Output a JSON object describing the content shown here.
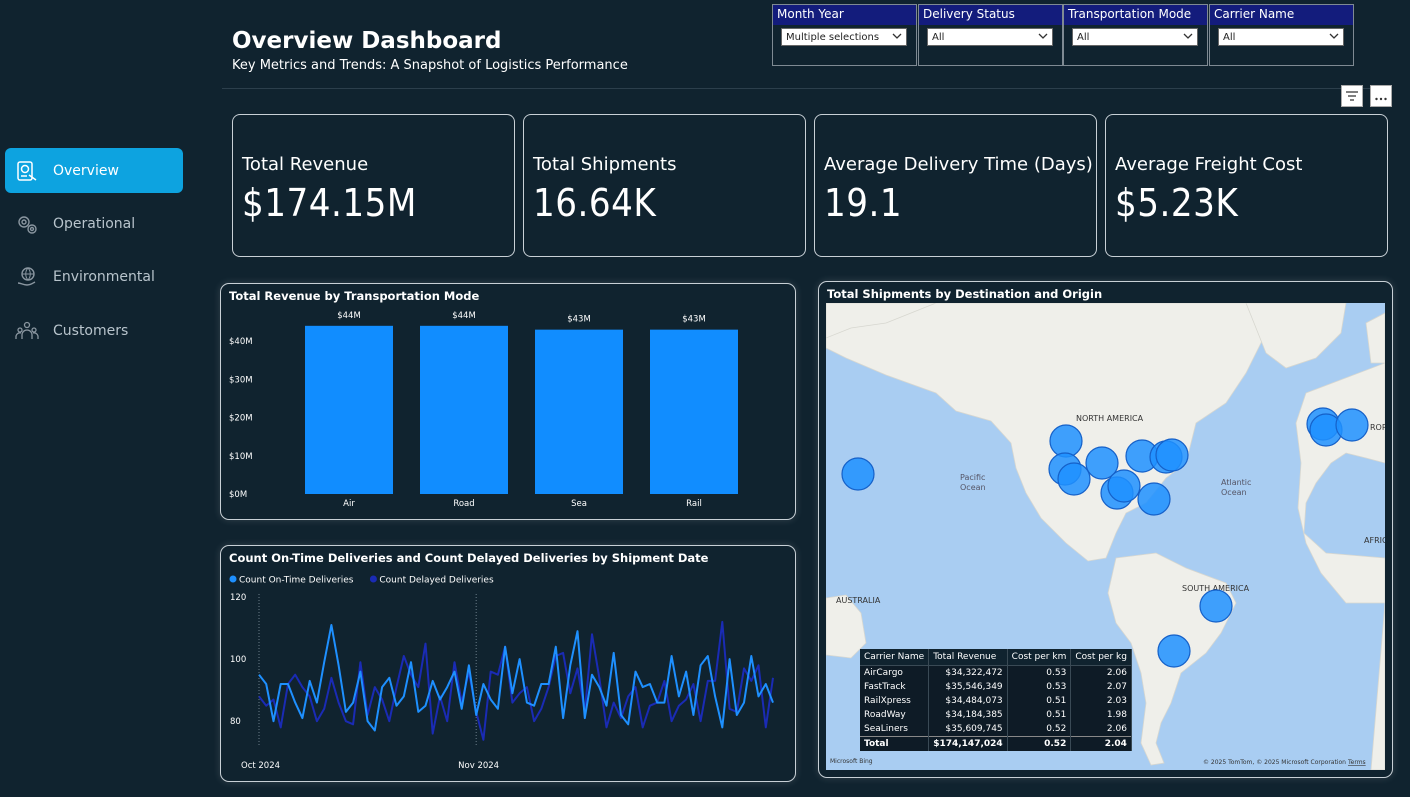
{
  "header": {
    "title": "Overview Dashboard",
    "subtitle": "Key Metrics and Trends: A Snapshot of Logistics Performance"
  },
  "sidebar": {
    "items": [
      {
        "label": "Overview",
        "icon": "overview-icon",
        "active": true
      },
      {
        "label": "Operational",
        "icon": "gears-icon",
        "active": false
      },
      {
        "label": "Environmental",
        "icon": "globe-hand-icon",
        "active": false
      },
      {
        "label": "Customers",
        "icon": "people-icon",
        "active": false
      }
    ]
  },
  "slicers": [
    {
      "label": "Month Year",
      "value": "Multiple selections"
    },
    {
      "label": "Delivery Status",
      "value": "All"
    },
    {
      "label": "Transportation Mode",
      "value": "All"
    },
    {
      "label": "Carrier Name",
      "value": "All"
    }
  ],
  "kpis": [
    {
      "label": "Total Revenue",
      "value": "$174.15M"
    },
    {
      "label": "Total Shipments",
      "value": "16.64K"
    },
    {
      "label": "Average Delivery Time (Days)",
      "value": "19.1"
    },
    {
      "label": "Average Freight Cost",
      "value": "$5.23K"
    }
  ],
  "colors": {
    "accent": "#0da3e0",
    "bar": "#118dff",
    "ontime": "#1e90ff",
    "delayed": "#1a2bb5",
    "bg": "#10232f"
  },
  "chart_data": [
    {
      "type": "bar",
      "title": "Total Revenue by Transportation Mode",
      "categories": [
        "Air",
        "Road",
        "Sea",
        "Rail"
      ],
      "values": [
        44,
        44,
        43,
        43
      ],
      "data_labels": [
        "$44M",
        "$44M",
        "$43M",
        "$43M"
      ],
      "y_ticks": [
        "$0M",
        "$10M",
        "$20M",
        "$30M",
        "$40M"
      ],
      "ylim": [
        0,
        45
      ]
    },
    {
      "type": "line",
      "title": "Count On-Time Deliveries and Count Delayed Deliveries by Shipment Date",
      "legend": "top-left",
      "x_ticks": [
        "Oct 2024",
        "Nov 2024"
      ],
      "y_ticks": [
        "80",
        "100",
        "120"
      ],
      "ylim": [
        72,
        121
      ],
      "series": [
        {
          "name": "Count On-Time Deliveries",
          "values": [
            95,
            92,
            80,
            92,
            92,
            86,
            81,
            93,
            86,
            99,
            111,
            98,
            83,
            86,
            96,
            80,
            77,
            91,
            94,
            85,
            88,
            99,
            83,
            85,
            93,
            87,
            91,
            96,
            84,
            98,
            82,
            92,
            87,
            84,
            104,
            89,
            100,
            86,
            85,
            92,
            92,
            104,
            81,
            98,
            109,
            81,
            95,
            91,
            85,
            102,
            82,
            79,
            96,
            91,
            92,
            86,
            86,
            101,
            88,
            96,
            82,
            98,
            101,
            88,
            78,
            100,
            82,
            86,
            101,
            88,
            92,
            86
          ]
        },
        {
          "name": "Count Delayed Deliveries",
          "values": [
            88,
            85,
            87,
            78,
            92,
            95,
            91,
            88,
            80,
            84,
            94,
            86,
            80,
            79,
            99,
            82,
            91,
            87,
            80,
            91,
            101,
            95,
            91,
            105,
            76,
            88,
            80,
            99,
            86,
            96,
            83,
            74,
            96,
            95,
            104,
            86,
            89,
            91,
            80,
            84,
            91,
            101,
            102,
            89,
            97,
            83,
            108,
            94,
            78,
            86,
            81,
            88,
            91,
            78,
            85,
            86,
            93,
            80,
            85,
            87,
            92,
            80,
            93,
            93,
            112,
            84,
            83,
            97,
            93,
            98,
            78,
            94
          ]
        }
      ]
    }
  ],
  "map": {
    "title": "Total Shipments by Destination and Origin",
    "labels": {
      "north_america": "NORTH AMERICA",
      "pacific": "Pacific",
      "pacific2": "Ocean",
      "atlantic": "Atlantic",
      "atlantic2": "Ocean",
      "south_america": "SOUTH AMERICA",
      "australia": "AUSTRALIA",
      "africa": "AFRIC",
      "europe": "ROP"
    },
    "copyright": "© 2025 TomTom, © 2025 Microsoft Corporation",
    "terms": "Terms",
    "bing": "Microsoft Bing"
  },
  "carrier_table": {
    "headers": [
      "Carrier Name",
      "Total Revenue",
      "Cost per km",
      "Cost per kg"
    ],
    "rows": [
      [
        "AirCargo",
        "$34,322,472",
        "0.53",
        "2.06"
      ],
      [
        "FastTrack",
        "$35,546,349",
        "0.53",
        "2.07"
      ],
      [
        "RailXpress",
        "$34,484,073",
        "0.51",
        "2.03"
      ],
      [
        "RoadWay",
        "$34,184,385",
        "0.51",
        "1.98"
      ],
      [
        "SeaLiners",
        "$35,609,745",
        "0.52",
        "2.06"
      ]
    ],
    "total": [
      "Total",
      "$174,147,024",
      "0.52",
      "2.04"
    ]
  }
}
